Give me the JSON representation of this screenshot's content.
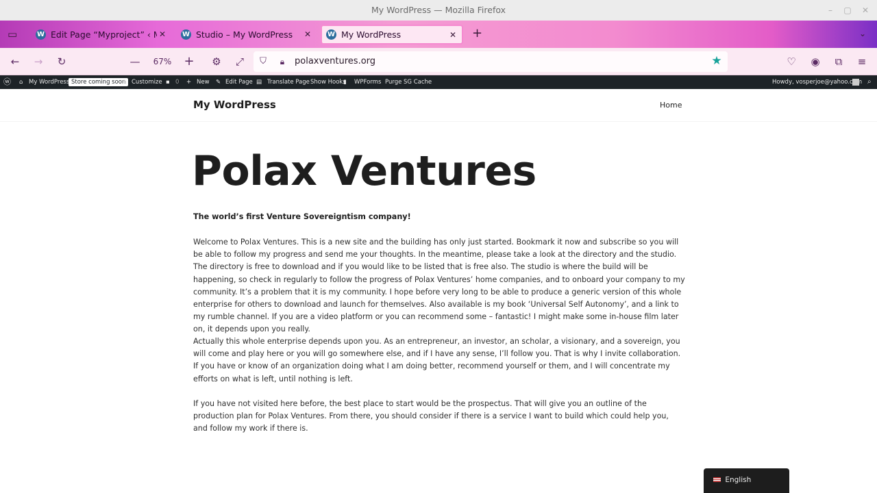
{
  "window": {
    "title": "My WordPress — Mozilla Firefox"
  },
  "tabs": [
    {
      "label": "Edit Page “Myproject” ‹ My W"
    },
    {
      "label": "Studio – My WordPress"
    },
    {
      "label": "My WordPress"
    }
  ],
  "toolbar": {
    "zoom": "67%",
    "url": "polaxventures.org"
  },
  "adminbar": {
    "site": "My WordPress",
    "store_badge": "Store coming soon",
    "customize": "Customize",
    "comments": "0",
    "new": "New",
    "edit_page": "Edit Page",
    "translate": "Translate Page",
    "show_hooks": "Show Hooks",
    "wpforms": "WPForms",
    "purge": "Purge SG Cache",
    "howdy": "Howdy, vosperjoe@yahoo.com"
  },
  "site": {
    "brand": "My WordPress",
    "nav_home": "Home",
    "heading": "Polax Ventures",
    "tagline": "The world’s first Venture Sovereigntism company!",
    "paragraphs": [
      "Welcome to Polax Ventures. This is a new site and the building has only just started. Bookmark it now and subscribe so you will be able to follow my progress and send me your thoughts. In the meantime, please take a look at the directory and the studio. The directory is free to download and if you would like to be listed that is free also. The studio is where the build will be happening, so check in regularly to follow the progress of Polax Ventures’ home companies, and to onboard your company to my community. It’s a problem that it is my community. I hope before very long to be able to produce a generic version of this whole enterprise for others to download and launch for themselves. Also available is my book ‘Universal Self Autonomy’, and a link to my rumble channel. If you are a video platform or you can recommend some – fantastic! I might make some in-house film later on, it depends upon you really.",
      "Actually this whole enterprise depends upon you. As an entrepreneur, an investor, an scholar, a visionary, and a sovereign, you will come and play here or you will go somewhere else, and if I have any sense, I’ll follow you. That is why I invite collaboration. If you have or know of an organization doing what I am doing better, recommend yourself or them, and I will concentrate my efforts on what is left, until nothing is left.",
      "If you have not visited here before, the best place to start would be the prospectus. That will give you an outline of the production plan for Polax Ventures. From there, you should consider if there is a service I want to build which could help you, and follow my work if there is."
    ],
    "language": "English"
  }
}
